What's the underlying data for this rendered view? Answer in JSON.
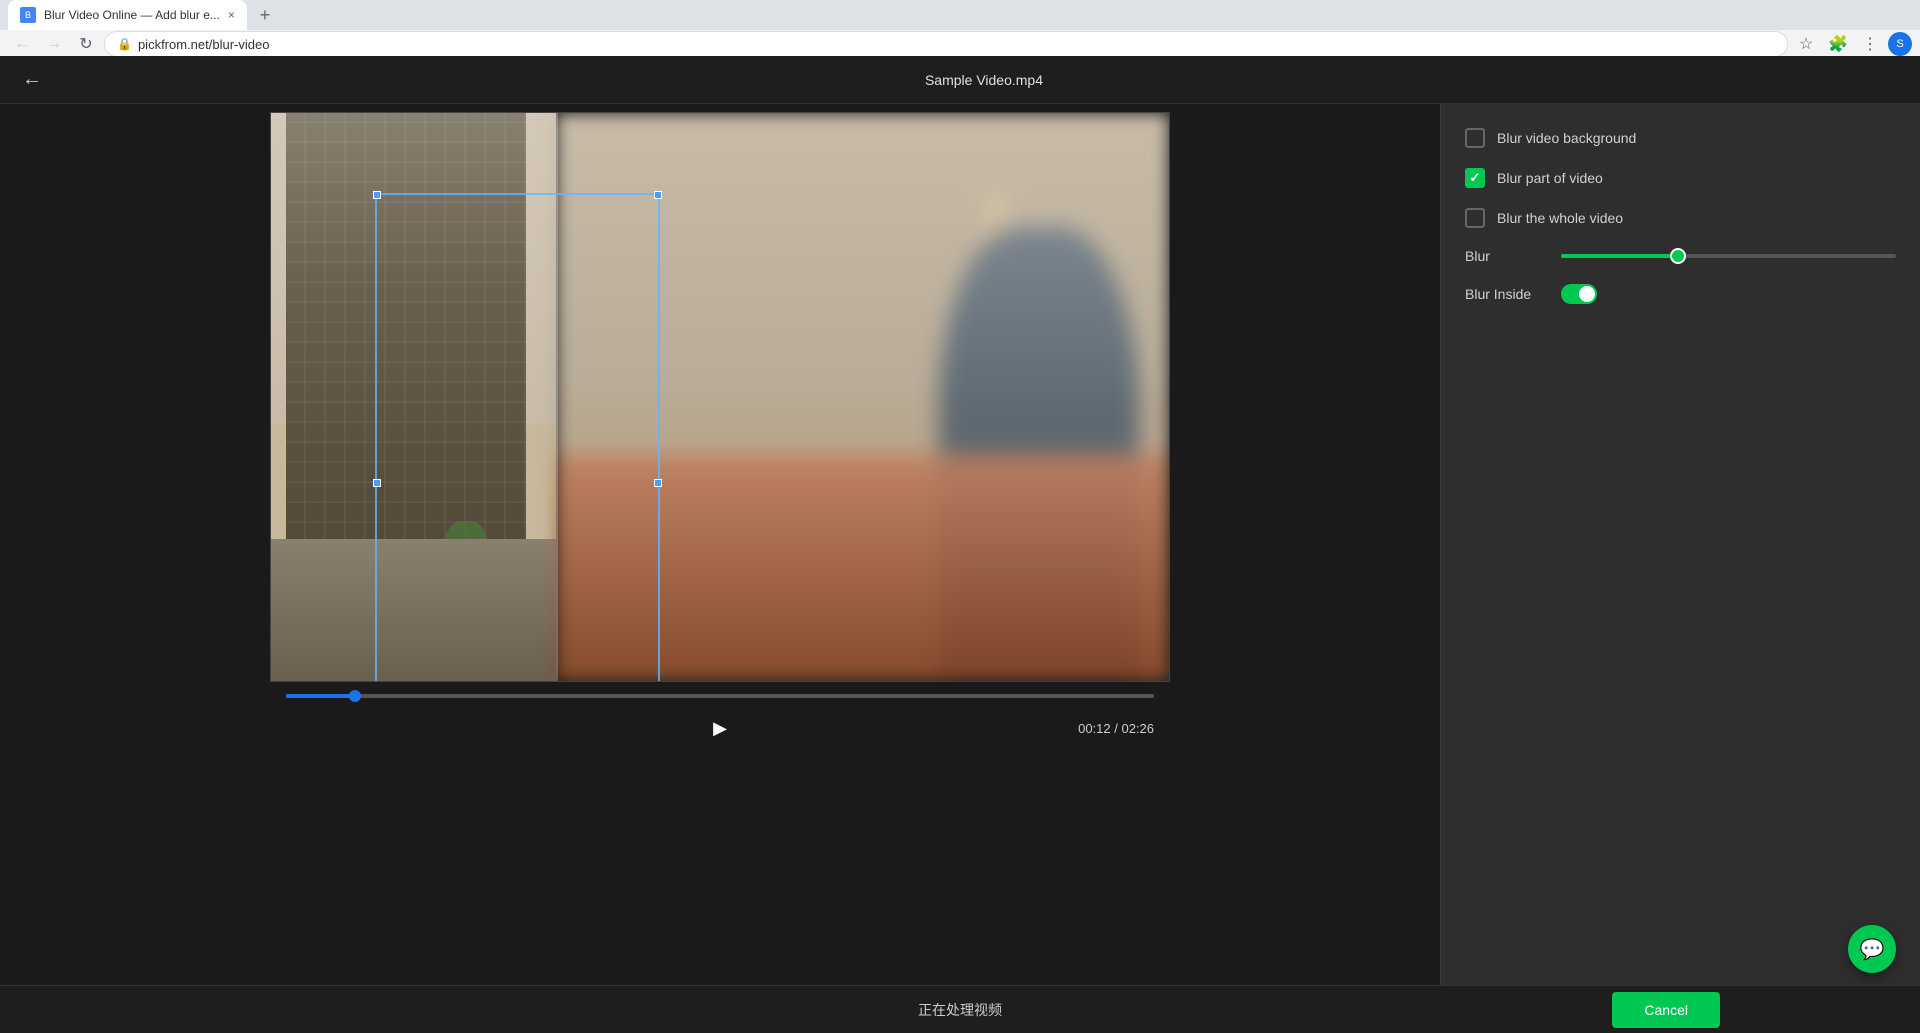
{
  "browser": {
    "tab_title": "Blur Video Online — Add blur e...",
    "tab_new_label": "+",
    "address": "pickfrom.net/blur-video",
    "back_disabled": false,
    "forward_disabled": false,
    "refresh_label": "↻",
    "favicon": "B"
  },
  "header": {
    "back_label": "←",
    "title": "Sample Video.mp4"
  },
  "video": {
    "time_current": "00:12",
    "time_total": "02:26",
    "time_display": "00:12 / 02:26",
    "progress_percent": 8,
    "play_icon": "▶"
  },
  "options": {
    "blur_background_label": "Blur video background",
    "blur_background_checked": false,
    "blur_part_label": "Blur part of video",
    "blur_part_checked": true,
    "blur_whole_label": "Blur the whole video",
    "blur_whole_checked": false,
    "blur_slider_label": "Blur",
    "blur_slider_value": 35,
    "blur_inside_label": "Blur Inside",
    "blur_inside_on": true
  },
  "bottom_bar": {
    "processing_text": "正在处理视频",
    "cancel_label": "Cancel"
  },
  "chat": {
    "icon": "💬"
  }
}
